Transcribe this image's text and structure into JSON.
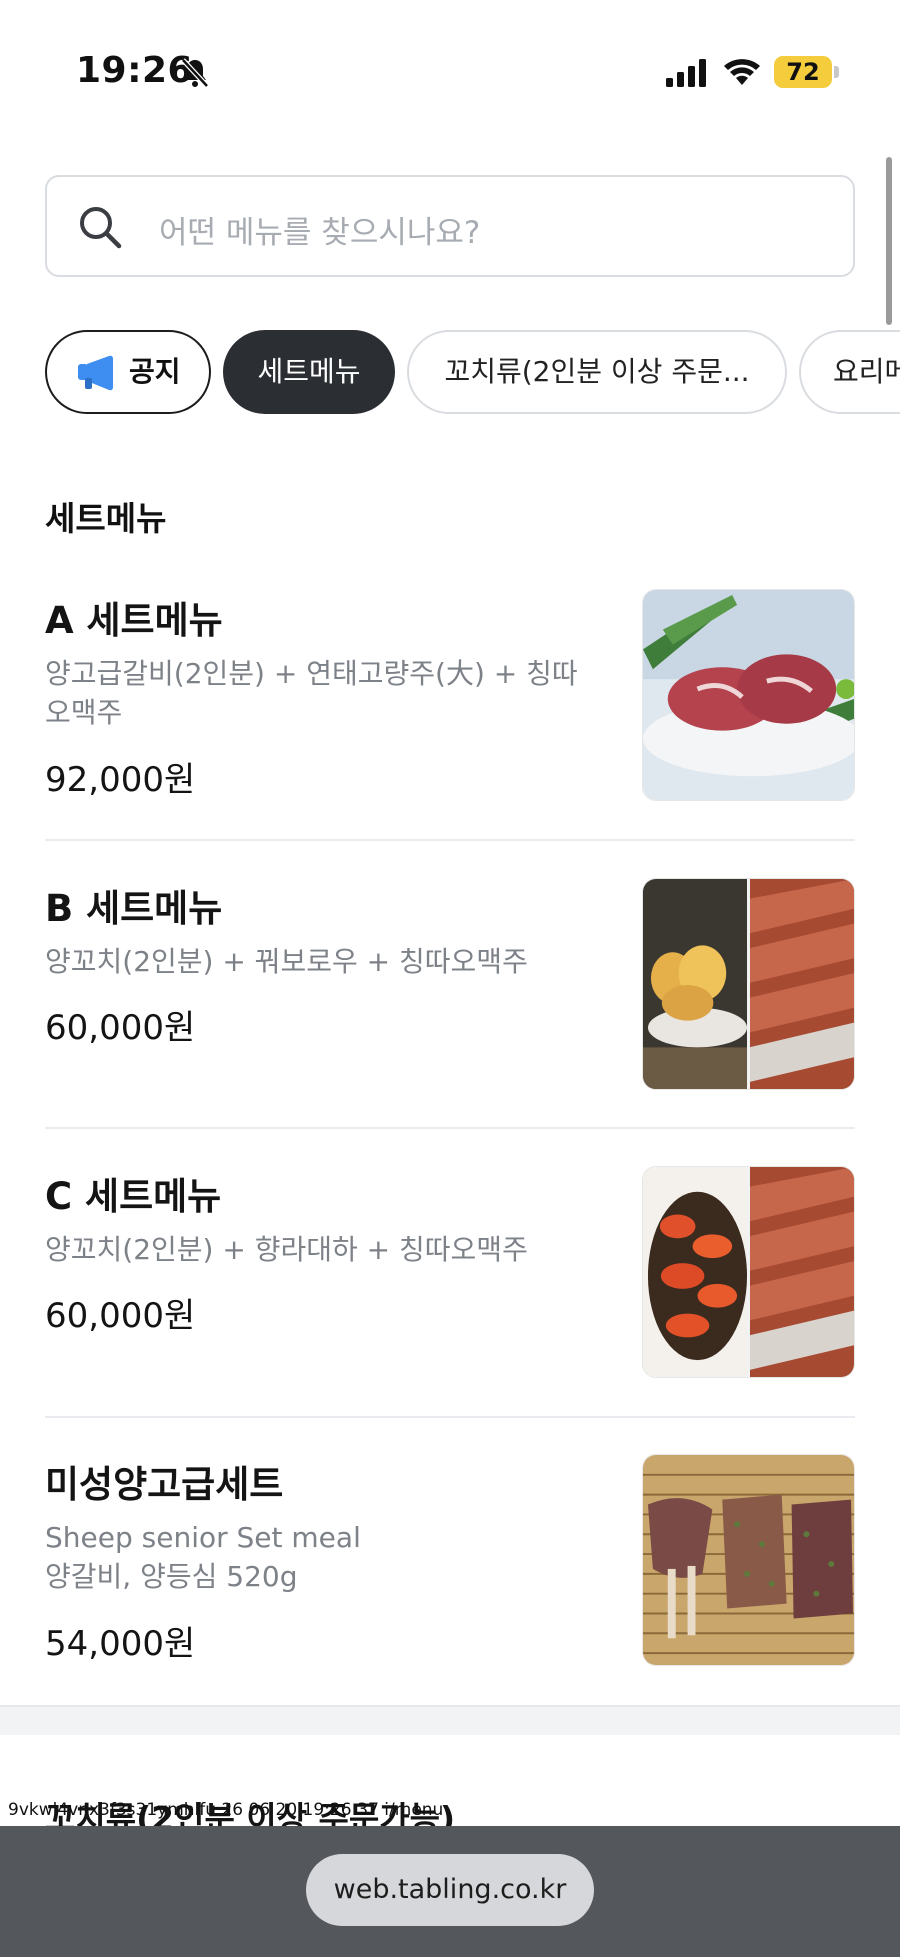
{
  "status_bar": {
    "time": "19:26",
    "battery": "72",
    "icons": [
      "bell-slash-icon",
      "signal-icon",
      "wifi-icon",
      "battery-icon"
    ]
  },
  "search": {
    "placeholder": "어떤 메뉴를 찾으시나요?"
  },
  "categories": [
    {
      "label": "공지",
      "icon": "megaphone-icon",
      "selected": false
    },
    {
      "label": "세트메뉴",
      "selected": true
    },
    {
      "label": "꼬치류(2인분 이상 주문...",
      "selected": false
    },
    {
      "label": "요리메",
      "selected": false
    }
  ],
  "section": {
    "title": "세트메뉴"
  },
  "menu_items": [
    {
      "name": "A 세트메뉴",
      "description_lines": [
        "양고급갈비(2인분) + 연태고량주(大) + 칭따",
        "오맥주"
      ],
      "price": "92,000원"
    },
    {
      "name": "B 세트메뉴",
      "description_lines": [
        "양꼬치(2인분) + 꿔보로우 + 칭따오맥주"
      ],
      "price": "60,000원"
    },
    {
      "name": "C 세트메뉴",
      "description_lines": [
        "양꼬치(2인분) + 향라대하 + 칭따오맥주"
      ],
      "price": "60,000원"
    },
    {
      "name": "미성양고급세트",
      "description_lines": [
        "Sheep senior Set meal",
        "양갈비, 양등심 520g"
      ],
      "price": "54,000원"
    }
  ],
  "next_section": {
    "title": "꼬치류(2인분 이상 주문가능)"
  },
  "overlay_code": "9vkwl4vnx3f3s31ymhlfu 26 06 20 19:26:37 i/menu",
  "browser": {
    "url": "web.tabling.co.kr"
  },
  "colors": {
    "accent_dark": "#2b2f33",
    "muted_text": "#7d8188",
    "megaphone_blue": "#3d8ef0",
    "bottom_bar": "#54575c"
  }
}
